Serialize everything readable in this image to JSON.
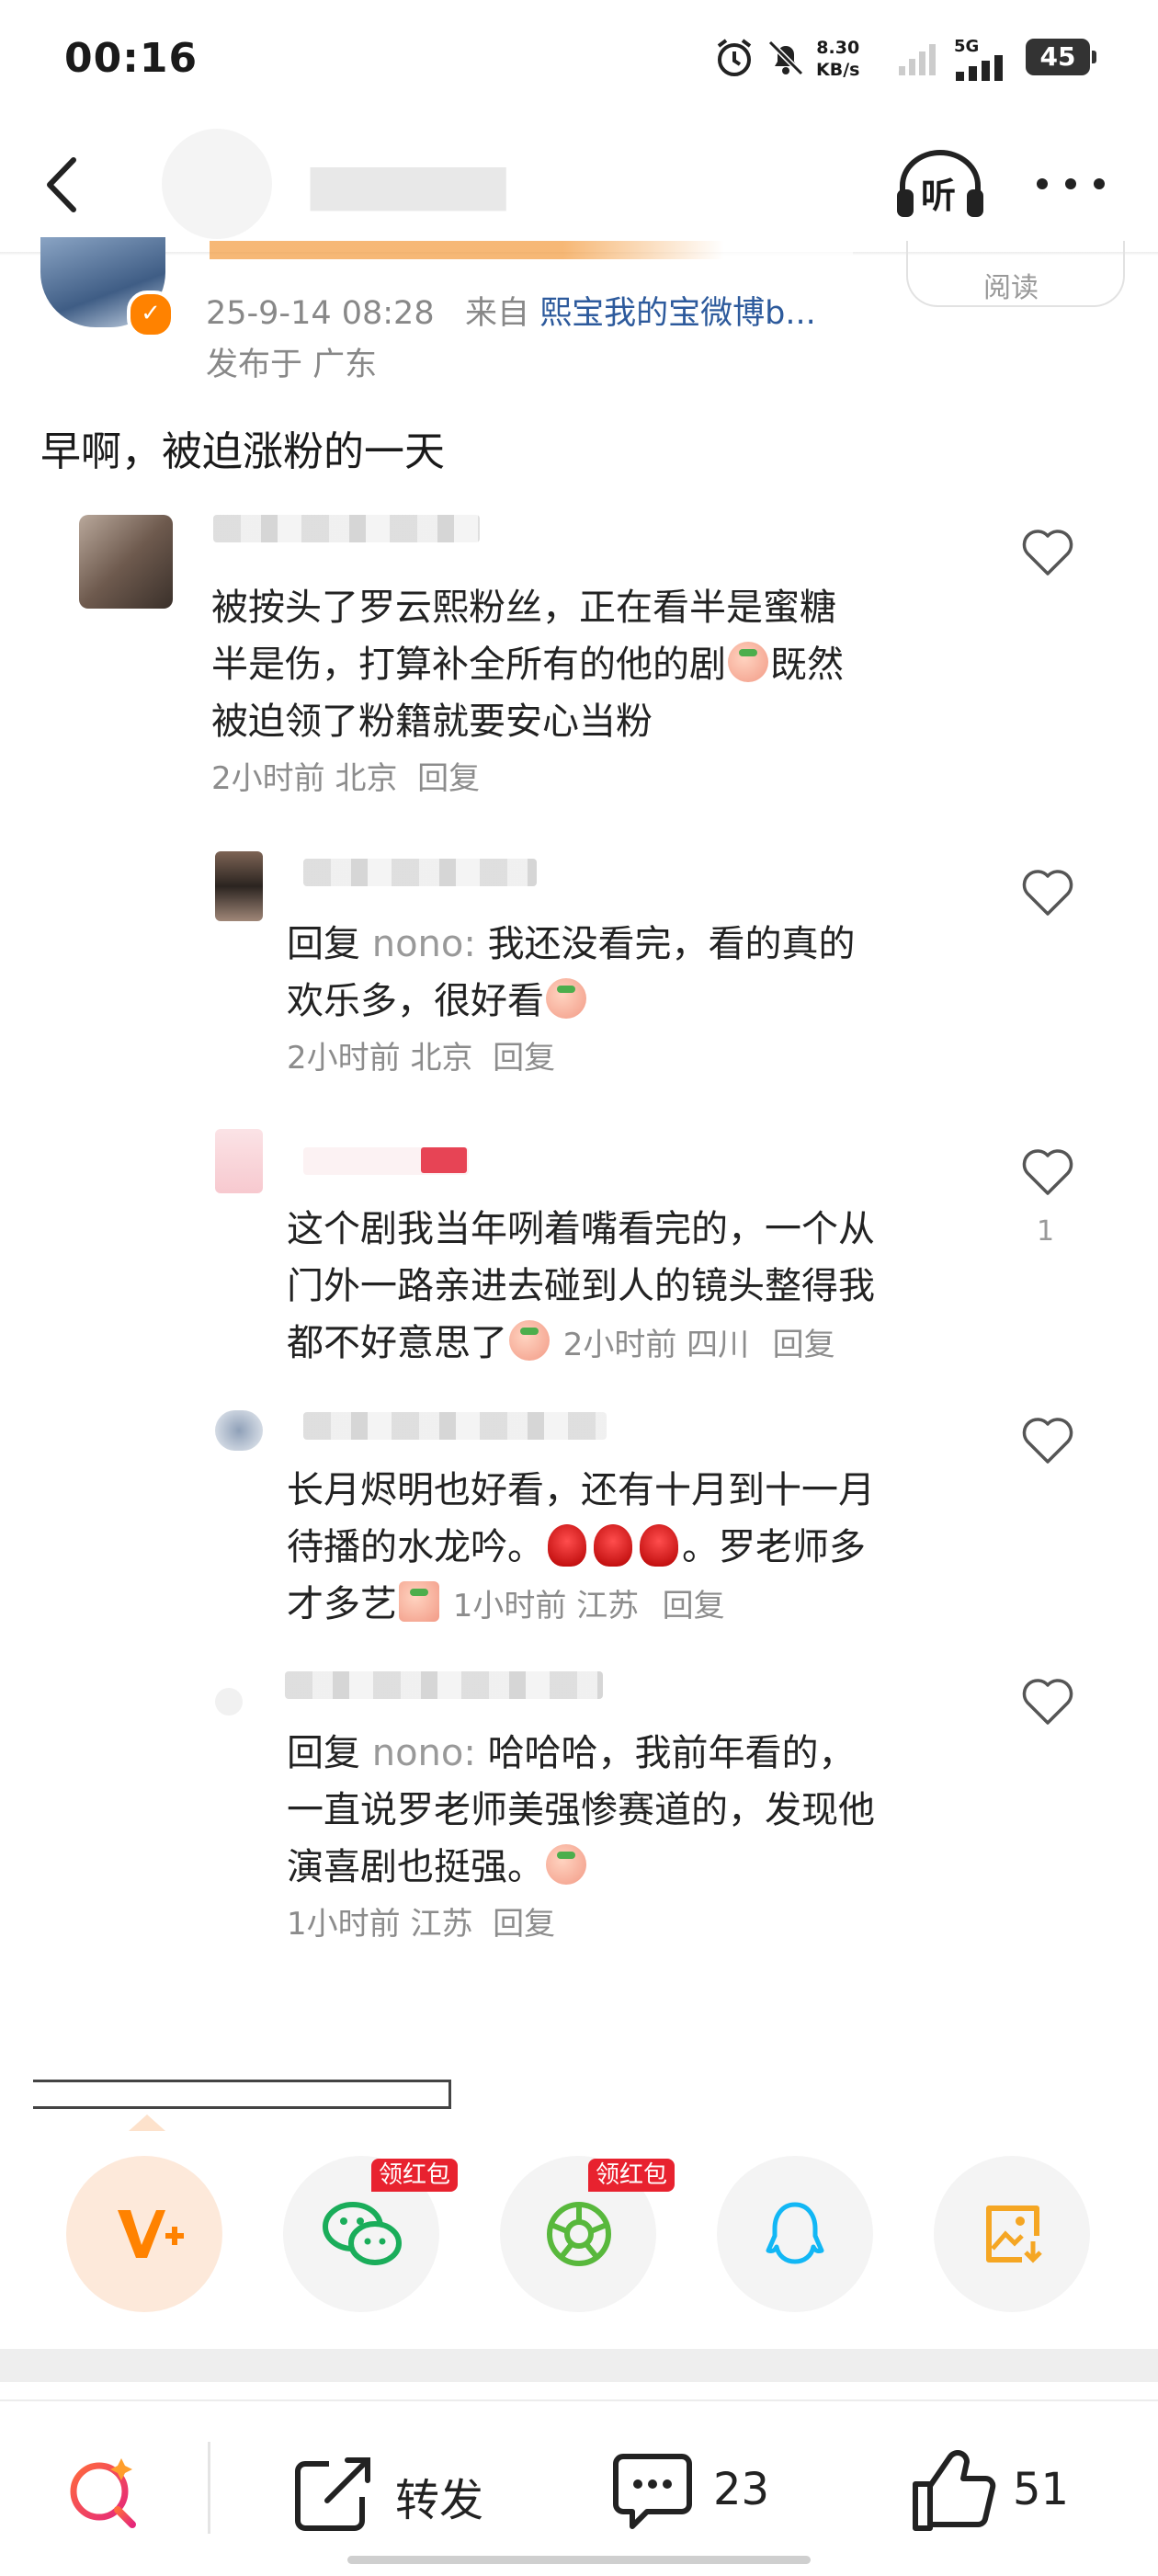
{
  "status_bar": {
    "time": "00:16",
    "net_speed_value": "8.30",
    "net_speed_unit": "KB/s",
    "network": "5G",
    "battery": "45"
  },
  "header": {
    "listen_label": "听",
    "more_icon": "more-dots-icon",
    "back_icon": "back-arrow-icon"
  },
  "post": {
    "date": "25-9-14 08:28",
    "from_label": "来自",
    "source": "熙宝我的宝微博b...",
    "location": "发布于 广东",
    "read_label": "阅读",
    "text": "早啊，被迫涨粉的一天"
  },
  "comments": [
    {
      "line1": "被按头了罗云熙粉丝，正在看半是蜜糖",
      "line2": "半是伤，打算补全所有的他的剧",
      "line2_after": "既然",
      "line3": "被迫领了粉籍就要安心当粉",
      "meta": "2小时前 北京",
      "reply": "回复"
    },
    {
      "reply_tag": "回复",
      "reply_user": "nono:",
      "line1": "我还没看完，看的真的",
      "line2": "欢乐多，很好看",
      "meta": "2小时前 北京",
      "reply": "回复"
    },
    {
      "line1": "这个剧我当年咧着嘴看完的，一个从",
      "line2": "门外一路亲进去碰到人的镜头整得我",
      "line3": "都不好意思了",
      "meta": "2小时前 四川",
      "reply": "回复",
      "likes": "1"
    },
    {
      "line1": "长月烬明也好看，还有十月到十一月",
      "line2a": "待播的水龙吟。",
      "line2b": "。罗老师多",
      "line3": "才多艺",
      "meta": "1小时前 江苏",
      "reply": "回复"
    },
    {
      "reply_tag": "回复",
      "reply_user": "nono:",
      "line1": "哈哈哈，我前年看的，",
      "line2": "一直说罗老师美强惨赛道的，发现他",
      "line3": "演喜剧也挺强。",
      "meta": "1小时前 江苏",
      "reply": "回复"
    }
  ],
  "share": {
    "red_packet_label": "领红包",
    "items": [
      "vplus-icon",
      "wechat-icon",
      "moments-icon",
      "qq-icon",
      "save-image-icon"
    ]
  },
  "bottom_bar": {
    "repost_label": "转发",
    "comment_count": "23",
    "like_count": "51"
  },
  "colors": {
    "accent_orange": "#ff8200",
    "link_blue": "#2d5a9c",
    "red_packet": "#e8222f"
  }
}
